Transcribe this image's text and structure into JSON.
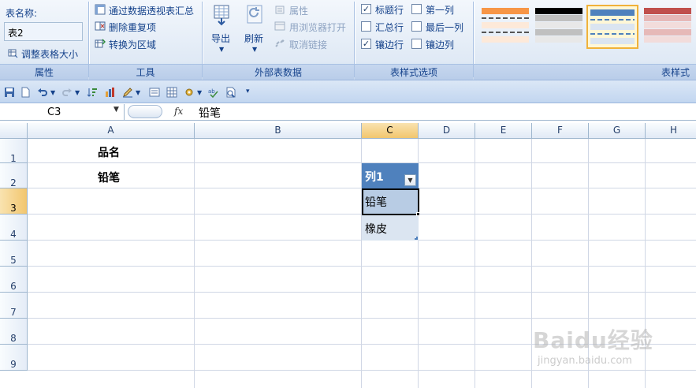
{
  "ribbon": {
    "table_name_label": "表名称:",
    "table_name_value": "表2",
    "resize_table": "调整表格大小",
    "props_group": "属性",
    "pivot_summary": "通过数据透视表汇总",
    "remove_duplicates": "删除重复项",
    "convert_to_range": "转换为区域",
    "tools_group": "工具",
    "export": "导出",
    "refresh": "刷新",
    "properties": "属性",
    "open_in_browser": "用浏览器打开",
    "unlink": "取消链接",
    "external_group": "外部表数据",
    "header_row": "标题行",
    "total_row": "汇总行",
    "banded_rows": "镶边行",
    "first_column": "第一列",
    "last_column": "最后一列",
    "banded_columns": "镶边列",
    "style_options_group": "表样式选项",
    "styles_group": "表样式",
    "header_row_checked": "✓",
    "banded_rows_checked": "✓"
  },
  "formula_bar": {
    "name_box": "C3",
    "fx": "fx",
    "content": "铅笔"
  },
  "grid": {
    "columns": [
      "A",
      "B",
      "C",
      "D",
      "E",
      "F",
      "G",
      "H"
    ],
    "rows": [
      "1",
      "2",
      "3",
      "4",
      "5",
      "6",
      "7",
      "8",
      "9"
    ],
    "cells": {
      "A1": "品名",
      "A2": "铅笔",
      "C2": "列1",
      "C3": "铅笔",
      "C4": "橡皮"
    }
  },
  "watermark": {
    "main": "Baidu经验",
    "sub": "jingyan.baidu.com"
  },
  "colors": {
    "table_header": "#4f81bd",
    "table_band1": "#b8cce4",
    "table_band2": "#dbe5f1",
    "active_header": "#f2c66e"
  }
}
